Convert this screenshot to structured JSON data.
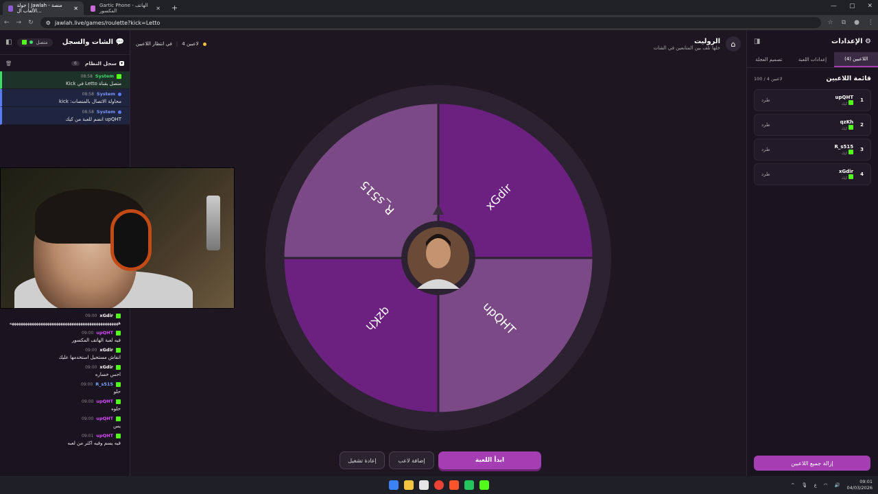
{
  "browser": {
    "tabs": [
      {
        "label": "جولة | Jawlah - منصة الألعاب ال..."
      },
      {
        "label": "Gartic Phone - الهاتف المكسور"
      }
    ],
    "url": "jawlah.live/games/roulette?kick=Letto"
  },
  "chat": {
    "title": "الشات والسجل",
    "status": "متصل",
    "syslog_title": "سجل النظام",
    "syslog_count": "6",
    "system_messages": [
      {
        "user": "System",
        "time": "08:58",
        "text": "متصل بقناة Letto في Kick"
      },
      {
        "user": "System",
        "time": "08:58",
        "text": "محاولة الاتصال بالمنصات: kick"
      },
      {
        "user": "System",
        "time": "08:58",
        "text": "upQHT انضم للعبة من كيك"
      }
    ],
    "messages": [
      {
        "user": "xGdir",
        "time": "09:00",
        "text": "هههههههههههههههههههههههههههههههههههههههههههههههههه",
        "color": "#ffffff"
      },
      {
        "user": "upQHT",
        "time": "09:00",
        "text": "فيه لعبة الهاتف المكسور",
        "color": "#d94aff"
      },
      {
        "user": "xGdir",
        "time": "09:00",
        "text": "انفاش مستحيل استخدمها عليك",
        "color": "#ffffff"
      },
      {
        "user": "xGdir",
        "time": "09:00",
        "text": "احس خساره",
        "color": "#ffffff"
      },
      {
        "user": "R_s515",
        "time": "09:00",
        "text": "حلو",
        "color": "#7aa6ff"
      },
      {
        "user": "upQHT",
        "time": "09:00",
        "text": "حلوه",
        "color": "#d94aff"
      },
      {
        "user": "upQHT",
        "time": "09:00",
        "text": "يس",
        "color": "#d94aff"
      },
      {
        "user": "upQHT",
        "time": "09:01",
        "text": "فيه يسم وفيه اكثر من لعبه",
        "color": "#d94aff"
      }
    ]
  },
  "game": {
    "title": "الروليت",
    "subtitle": "خلها تلف بين المتابعين في الشات",
    "waiting_label": "في انتظار اللاعبين",
    "players_label": "4 لاعبين",
    "wheel": [
      {
        "name": "R_s515",
        "color": "#7b4a86"
      },
      {
        "name": "xGdir",
        "color": "#6c2080"
      },
      {
        "name": "upQHT",
        "color": "#7b4a86"
      },
      {
        "name": "qzKh",
        "color": "#6c2080"
      }
    ],
    "buttons": {
      "start": "ابدأ اللعبة",
      "add_player": "إضافة لاعب",
      "restart": "إعادة تشغيل"
    }
  },
  "settings": {
    "title": "الإعدادات",
    "tabs": [
      "اللاعبين (4)",
      "إعدادات اللعبة",
      "تصميم العجلة"
    ],
    "list_title": "قائمة اللاعبين",
    "list_count": "100 / 4 لاعبين",
    "kick_label": "طرد",
    "platform_label": "كيك",
    "players": [
      {
        "num": "1",
        "name": "upQHT"
      },
      {
        "num": "2",
        "name": "qzKh"
      },
      {
        "num": "3",
        "name": "R_s515"
      },
      {
        "num": "4",
        "name": "xGdir"
      }
    ],
    "remove_all": "إزالة جميع اللاعبين"
  },
  "taskbar": {
    "lang": "ع",
    "time": "09:01",
    "date": "04/03/2026"
  }
}
